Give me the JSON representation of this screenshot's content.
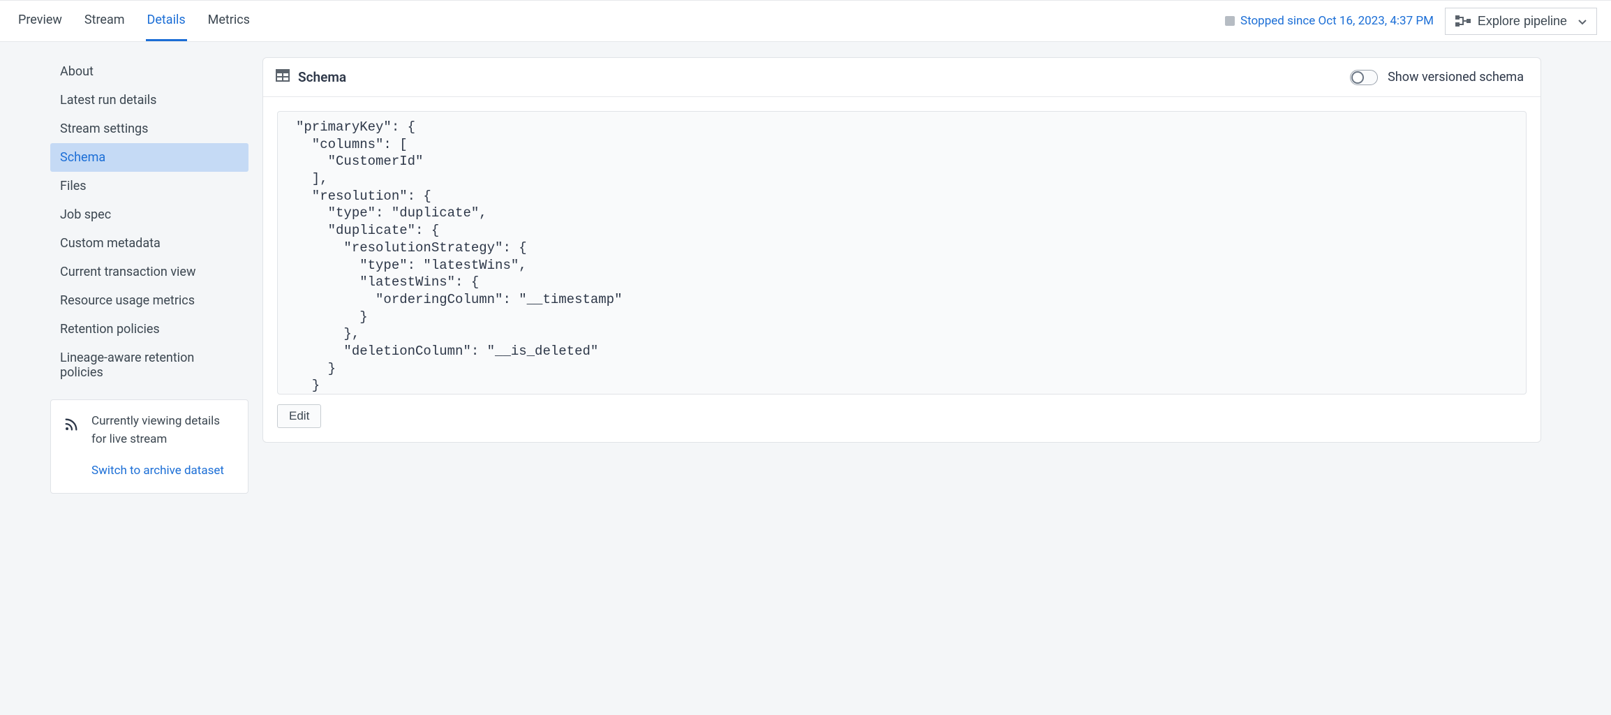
{
  "tabs": {
    "preview": "Preview",
    "stream": "Stream",
    "details": "Details",
    "metrics": "Metrics"
  },
  "status_text": "Stopped since Oct 16, 2023, 4:37 PM",
  "explore_button": "Explore pipeline",
  "sidebar": {
    "items": [
      "About",
      "Latest run details",
      "Stream settings",
      "Schema",
      "Files",
      "Job spec",
      "Custom metadata",
      "Current transaction view",
      "Resource usage metrics",
      "Retention policies",
      "Lineage-aware retention policies"
    ],
    "active_index": 3
  },
  "live_card": {
    "line1": "Currently viewing details",
    "line2": "for live stream",
    "link": "Switch to archive dataset"
  },
  "panel": {
    "title": "Schema",
    "toggle_label": "Show versioned schema",
    "edit_button": "Edit",
    "code": "\"primaryKey\": {\n  \"columns\": [\n    \"CustomerId\"\n  ],\n  \"resolution\": {\n    \"type\": \"duplicate\",\n    \"duplicate\": {\n      \"resolutionStrategy\": {\n        \"type\": \"latestWins\",\n        \"latestWins\": {\n          \"orderingColumn\": \"__timestamp\"\n        }\n      },\n      \"deletionColumn\": \"__is_deleted\"\n    }\n  }\n}"
  }
}
